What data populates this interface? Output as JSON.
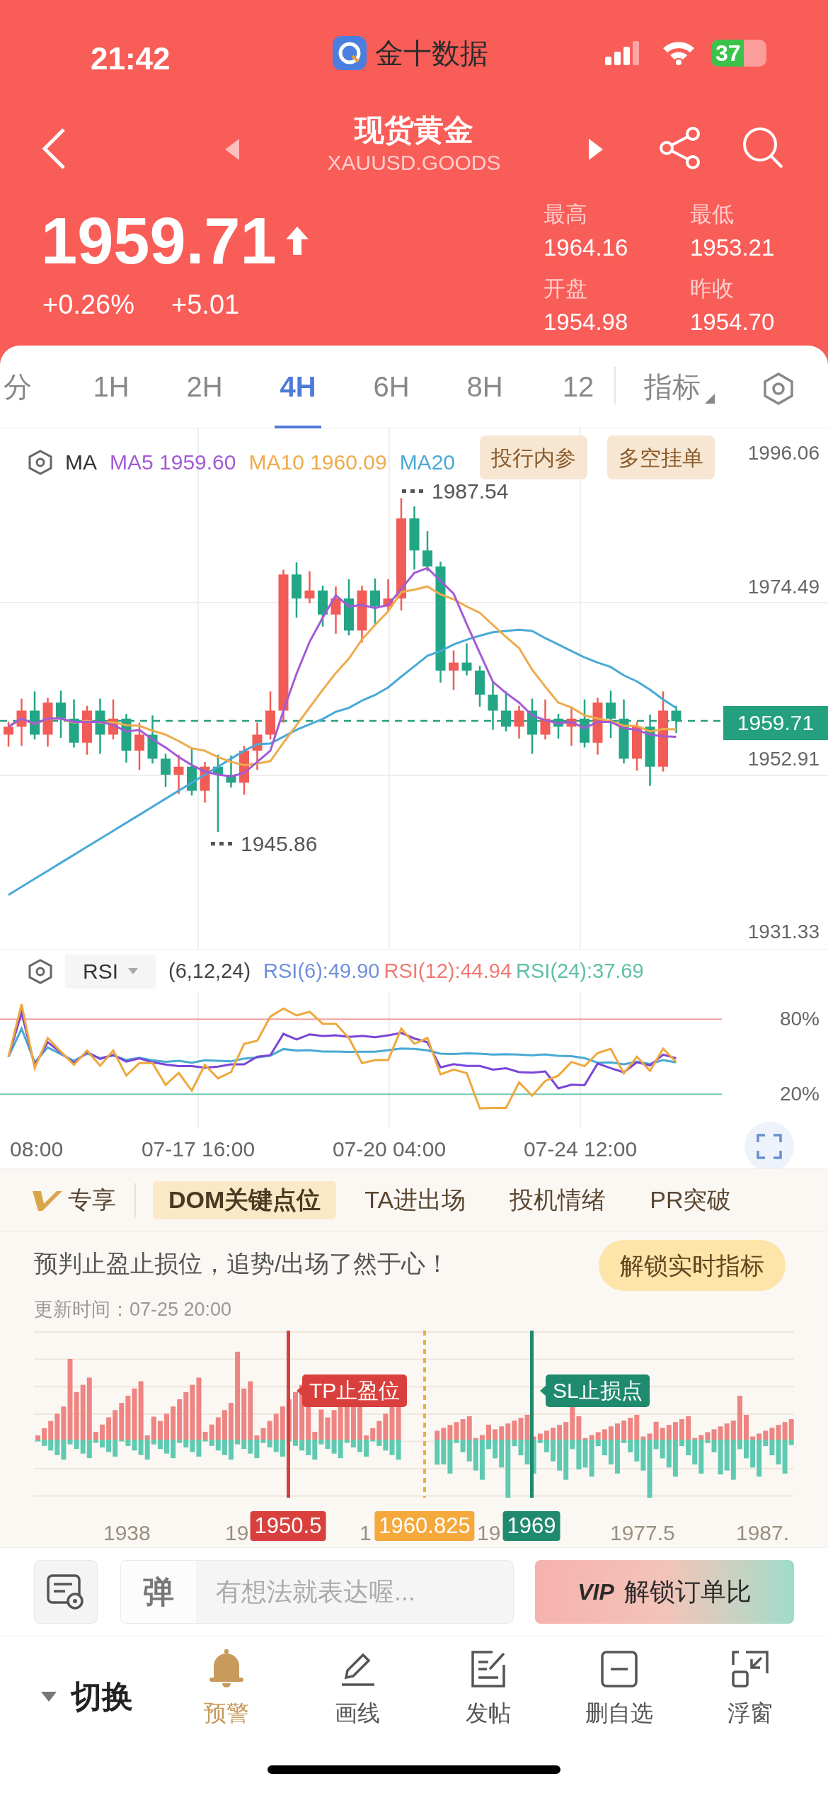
{
  "status_bar": {
    "time": "21:42",
    "back_app": "金十数据",
    "battery": "37"
  },
  "header": {
    "title": "现货黄金",
    "symbol": "XAUUSD.GOODS",
    "price": "1959.71",
    "change_pct": "+0.26%",
    "change": "+5.01",
    "stats": [
      {
        "label": "最高",
        "value": "1964.16"
      },
      {
        "label": "最低",
        "value": "1953.21"
      },
      {
        "label": "开盘",
        "value": "1954.98"
      },
      {
        "label": "昨收",
        "value": "1954.70"
      }
    ]
  },
  "period_tabs": [
    {
      "label": "分",
      "selected": false
    },
    {
      "label": "1H",
      "selected": false
    },
    {
      "label": "2H",
      "selected": false
    },
    {
      "label": "4H",
      "selected": true
    },
    {
      "label": "6H",
      "selected": false
    },
    {
      "label": "8H",
      "selected": false
    },
    {
      "label": "12",
      "selected": false
    }
  ],
  "indicator_menu": "指标",
  "main_chart": {
    "legend_label": "MA",
    "legend": [
      {
        "text": "MA5 1959.60",
        "color": "#a45ad6"
      },
      {
        "text": "MA10 1960.09",
        "color": "#eeab4c"
      },
      {
        "text": "MA20",
        "color": "#4aa9d6"
      }
    ],
    "buttons": [
      "投行内参",
      "多空挂单"
    ],
    "y_labels": [
      "1996.06",
      "1974.49",
      "1952.91",
      "1931.33"
    ],
    "current_price": "1959.71",
    "high_mark": "1987.54",
    "low_mark": "1945.86"
  },
  "rsi": {
    "selector": "RSI",
    "params": "(6,12,24)",
    "values": [
      {
        "text": "RSI(6):49.90",
        "color": "#6f90dc"
      },
      {
        "text": "RSI(12):44.94",
        "color": "#ef7a72"
      },
      {
        "text": "RSI(24):37.69",
        "color": "#5dc0a6"
      }
    ],
    "levels": [
      "80%",
      "20%"
    ]
  },
  "time_axis": [
    "08:00",
    "07-17 16:00",
    "07-20 04:00",
    "07-24 12:00"
  ],
  "exclusive_label": "专享",
  "section_tabs": [
    {
      "label": "DOM关键点位",
      "selected": true
    },
    {
      "label": "TA进出场",
      "selected": false
    },
    {
      "label": "投机情绪",
      "selected": false
    },
    {
      "label": "PR突破",
      "selected": false
    }
  ],
  "dom": {
    "headline": "预判止盈止损位，追势/出场了然于心！",
    "unlock_button": "解锁实时指标",
    "updated": "更新时间：07-25 20:00",
    "x_labels": [
      "1938",
      "19",
      "1",
      "19",
      "1977.5",
      "1987."
    ],
    "markers": [
      {
        "kind": "take_profit",
        "value": "1950.5",
        "tag": "TP止盈位",
        "color": "#d9403d"
      },
      {
        "kind": "current",
        "value": "1960.825",
        "color": "#f5a93c"
      },
      {
        "kind": "stop_loss",
        "value": "1969",
        "tag": "SL止损点",
        "color": "#1f8a6d"
      }
    ]
  },
  "composer": {
    "danmaku_icon": "弹",
    "placeholder": "有想法就表达喔...",
    "vip_badge": "VIP",
    "vip_button": "解锁订单比"
  },
  "bottom_nav": {
    "switch": "切换",
    "items": [
      {
        "label": "预警",
        "selected": true
      },
      {
        "label": "画线",
        "selected": false
      },
      {
        "label": "发帖",
        "selected": false
      },
      {
        "label": "删自选",
        "selected": false
      },
      {
        "label": "浮窗",
        "selected": false
      }
    ]
  }
}
